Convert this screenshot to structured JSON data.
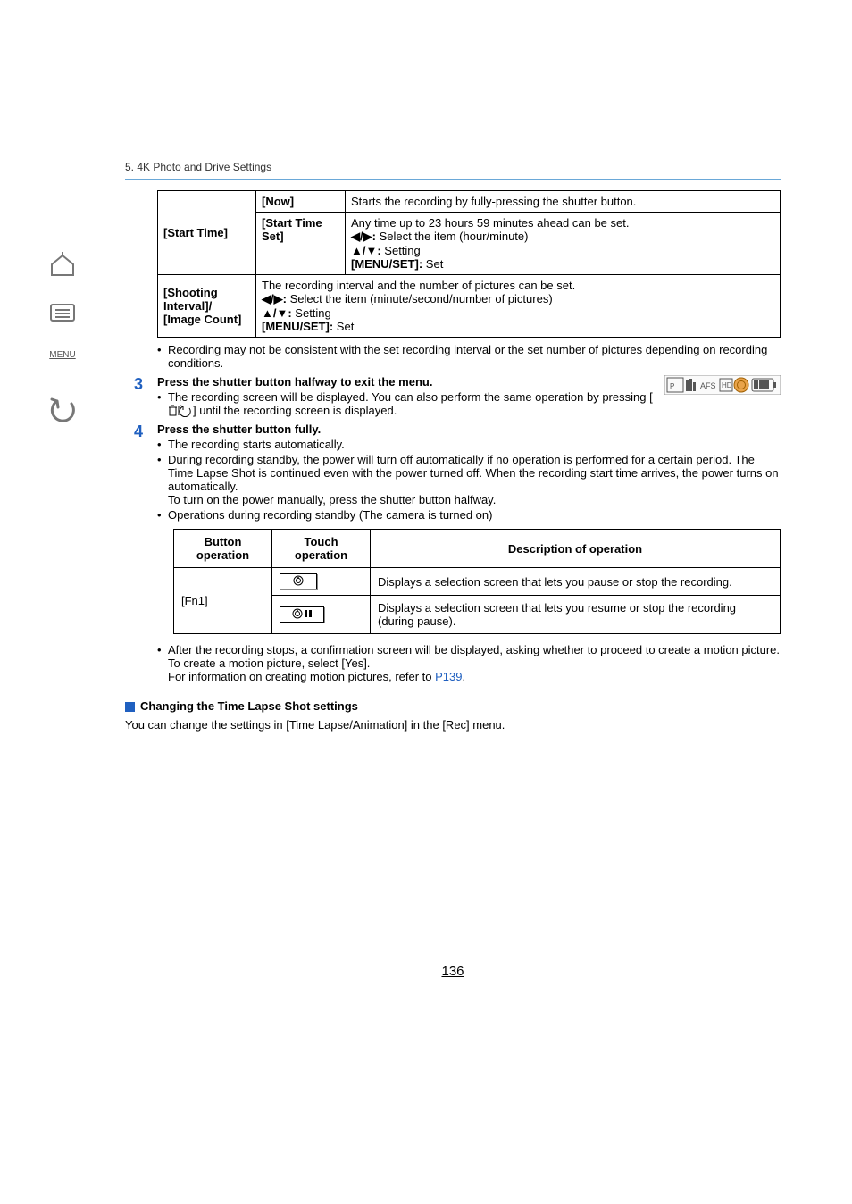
{
  "chapter": "5. 4K Photo and Drive Settings",
  "sidebar": {
    "menu_label": "MENU"
  },
  "settings_table": {
    "start_time_label": "[Start Time]",
    "now_label": "[Now]",
    "now_desc": "Starts the recording by fully-pressing the shutter button.",
    "start_time_set_label": "[Start Time Set]",
    "stset_line1": "Any time up to 23 hours 59 minutes ahead can be set.",
    "stset_line2_suffix": "Select the item (hour/minute)",
    "stset_line3_suffix": "Setting",
    "stset_line4_prefix": "[MENU/SET]:",
    "stset_line4_suffix": "Set",
    "interval_label": "[Shooting Interval]/\n[Image Count]",
    "interval_line1": "The recording interval and the number of pictures can be set.",
    "interval_line2_suffix": "Select the item (minute/second/number of pictures)",
    "interval_line3_suffix": "Setting",
    "interval_line4_prefix": "[MENU/SET]:",
    "interval_line4_suffix": "Set"
  },
  "note1": "Recording may not be consistent with the set recording interval or the set number of pictures depending on recording conditions.",
  "step3": {
    "num": "3",
    "title": "Press the shutter button halfway to exit the menu.",
    "sub_prefix": "The recording screen will be displayed. You can also perform the same operation by pressing [",
    "sub_suffix": "] until the recording screen is displayed."
  },
  "step4": {
    "num": "4",
    "title": "Press the shutter button fully.",
    "b1": "The recording starts automatically.",
    "b2": "During recording standby, the power will turn off automatically if no operation is performed for a certain period. The Time Lapse Shot is continued even with the power turned off. When the recording start time arrives, the power turns on automatically.",
    "b2_line2": "To turn on the power manually, press the shutter button halfway.",
    "b3": "Operations during recording standby (The camera is turned on)"
  },
  "ops_table": {
    "h1": "Button operation",
    "h2": "Touch operation",
    "h3": "Description of operation",
    "btn": "[Fn1]",
    "touch1": "⦾",
    "touch2": "⦾∥",
    "desc1": "Displays a selection screen that lets you pause or stop the recording.",
    "desc2": "Displays a selection screen that lets you resume or stop the recording (during pause)."
  },
  "after": {
    "line1": "After the recording stops, a confirmation screen will be displayed, asking whether to proceed to create a motion picture.",
    "line2": "To create a motion picture, select [Yes].",
    "line3_prefix": "For information on creating motion pictures, refer to ",
    "line3_link": "P139",
    "line3_suffix": "."
  },
  "changing": {
    "heading": "Changing the Time Lapse Shot settings",
    "body": "You can change the settings in [Time Lapse/Animation] in the [Rec] menu."
  },
  "page_number": "136"
}
